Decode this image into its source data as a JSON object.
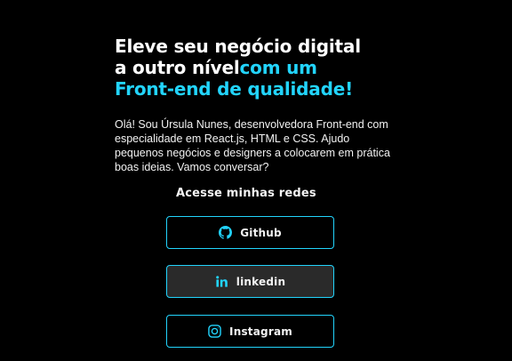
{
  "hero": {
    "headline_line1": "Eleve seu negócio digital",
    "headline_line2_white": "a outro nível",
    "headline_line2_accent": "com um",
    "headline_line3_accent": "Front-end de qualidade!",
    "bio": "Olá! Sou Úrsula Nunes, desenvolvedora Front-end com especialidade em React.js, HTML e CSS. Ajudo pequenos negócios e designers a colocarem em prática boas ideias. Vamos conversar?"
  },
  "social": {
    "title": "Acesse minhas redes",
    "buttons": [
      {
        "label": "Github",
        "icon": "github-icon"
      },
      {
        "label": "linkedin",
        "icon": "linkedin-icon"
      },
      {
        "label": "Instagram",
        "icon": "instagram-icon"
      }
    ]
  },
  "colors": {
    "background": "#000000",
    "accent": "#22d4fd",
    "text": "#ffffff",
    "button_hover": "#2a2a2a"
  }
}
